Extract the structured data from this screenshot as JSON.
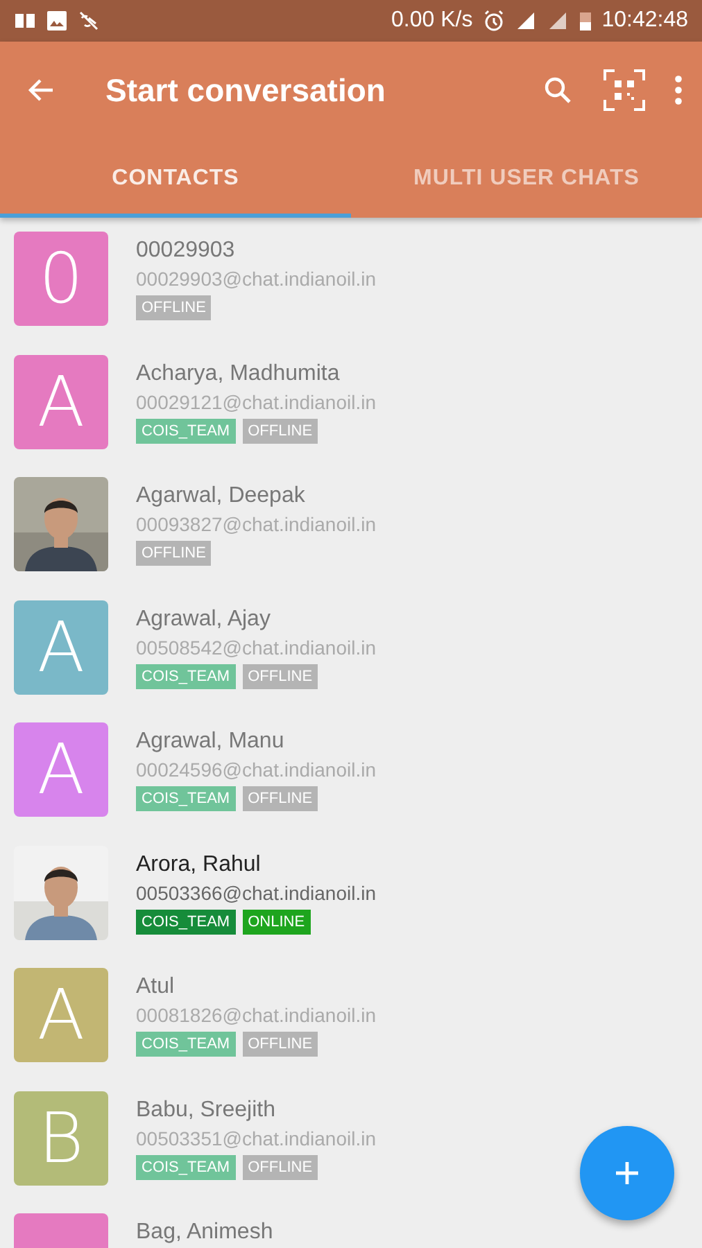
{
  "status_bar": {
    "speed": "0.00 K/s",
    "time": "10:42:48"
  },
  "toolbar": {
    "title": "Start conversation"
  },
  "tabs": [
    {
      "label": "CONTACTS",
      "selected": true
    },
    {
      "label": "MULTI USER CHATS",
      "selected": false
    }
  ],
  "contacts": [
    {
      "name": "00029903",
      "jid": "00029903@chat.indianoil.in",
      "avatar": {
        "kind": "letter",
        "letter": "0",
        "color": "#e57ac0"
      },
      "status": "OFFLINE",
      "online": false
    },
    {
      "name": "Acharya, Madhumita",
      "jid": "00029121@chat.indianoil.in",
      "avatar": {
        "kind": "letter",
        "letter": "A",
        "color": "#e57ac0"
      },
      "tags": [
        "COIS_TEAM"
      ],
      "status": "OFFLINE",
      "online": false
    },
    {
      "name": "Agarwal, Deepak",
      "jid": "00093827@chat.indianoil.in",
      "avatar": {
        "kind": "picture"
      },
      "status": "OFFLINE",
      "online": false
    },
    {
      "name": "Agrawal, Ajay",
      "jid": "00508542@chat.indianoil.in",
      "avatar": {
        "kind": "letter",
        "letter": "A",
        "color": "#7ab8c8"
      },
      "tags": [
        "COIS_TEAM"
      ],
      "status": "OFFLINE",
      "online": false
    },
    {
      "name": "Agrawal, Manu",
      "jid": "00024596@chat.indianoil.in",
      "avatar": {
        "kind": "letter",
        "letter": "A",
        "color": "#d784ec"
      },
      "tags": [
        "COIS_TEAM"
      ],
      "status": "OFFLINE",
      "online": false
    },
    {
      "name": "Arora, Rahul",
      "jid": "00503366@chat.indianoil.in",
      "avatar": {
        "kind": "picture"
      },
      "tags": [
        "COIS_TEAM"
      ],
      "status": "ONLINE",
      "online": true
    },
    {
      "name": "Atul",
      "jid": "00081826@chat.indianoil.in",
      "avatar": {
        "kind": "letter",
        "letter": "A",
        "color": "#c2b673"
      },
      "tags": [
        "COIS_TEAM"
      ],
      "status": "OFFLINE",
      "online": false
    },
    {
      "name": "Babu, Sreejith",
      "jid": "00503351@chat.indianoil.in",
      "avatar": {
        "kind": "letter",
        "letter": "B",
        "color": "#b3bb78"
      },
      "tags": [
        "COIS_TEAM"
      ],
      "status": "OFFLINE",
      "online": false
    },
    {
      "name": "Bag, Animesh",
      "avatar": {
        "kind": "letter",
        "color": "#e57ac0"
      },
      "online": false
    }
  ]
}
